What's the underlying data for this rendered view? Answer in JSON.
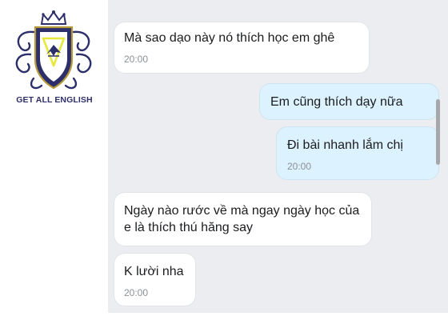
{
  "logo": {
    "text": "GET ALL ENGLISH"
  },
  "messages": [
    {
      "direction": "incoming",
      "text": "Mà sao dạo này nó thích học em ghê",
      "time": "20:00"
    },
    {
      "direction": "outgoing",
      "text": "Em cũng thích dạy nữa",
      "time": ""
    },
    {
      "direction": "outgoing",
      "text": "Đi bài nhanh lắm chị",
      "time": "20:00"
    },
    {
      "direction": "incoming",
      "text": "Ngày nào rước về mà ngay ngày học của e là thích thú hăng say",
      "time": ""
    },
    {
      "direction": "incoming",
      "text": "K lười nha",
      "time": "20:00"
    }
  ],
  "colors": {
    "chat_background": "#ebedf0",
    "incoming_bubble": "#ffffff",
    "outgoing_bubble": "#dcf2fe",
    "timestamp": "#8c9097",
    "logo_navy": "#2d2f6b",
    "logo_gold": "#b59a3c",
    "logo_yellow": "#e7e83a"
  }
}
